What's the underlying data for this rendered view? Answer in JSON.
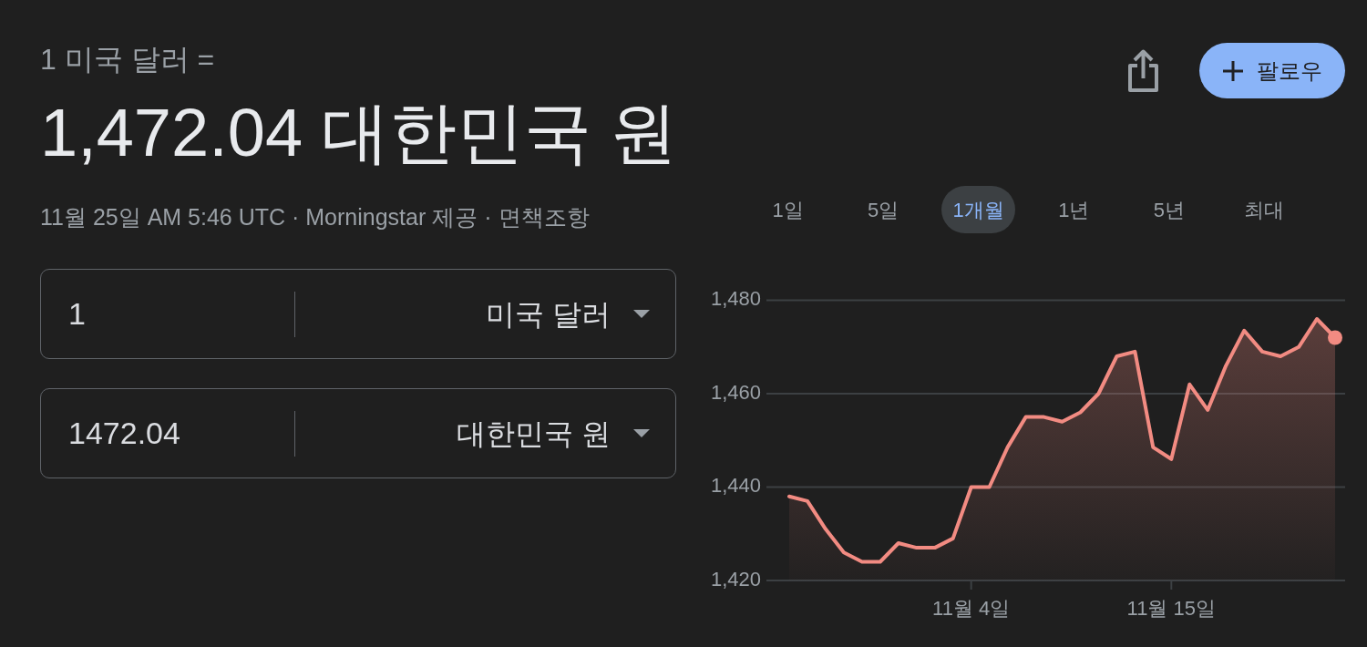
{
  "header": {
    "base_label": "1 미국 달러 =",
    "converted_value": "1,472.04 대한민국 원",
    "update_info": "11월 25일 AM 5:46 UTC · Morningstar 제공 ·",
    "disclaimer_link": "면책조항"
  },
  "actions": {
    "follow_button": "팔로우"
  },
  "converter": [
    {
      "amount": "1",
      "currency": "미국 달러"
    },
    {
      "amount": "1472.04",
      "currency": "대한민국 원"
    }
  ],
  "range_tabs": [
    {
      "label": "1일",
      "selected": false
    },
    {
      "label": "5일",
      "selected": false
    },
    {
      "label": "1개월",
      "selected": true
    },
    {
      "label": "1년",
      "selected": false
    },
    {
      "label": "5년",
      "selected": false
    },
    {
      "label": "최대",
      "selected": false
    }
  ],
  "chart": {
    "chart_data": {
      "type": "area",
      "categories": [
        null,
        null,
        null,
        null,
        null,
        null,
        null,
        null,
        null,
        null,
        "11월 4일",
        null,
        null,
        null,
        null,
        null,
        null,
        null,
        null,
        null,
        null,
        "11월 15일",
        null,
        null,
        null,
        null,
        null,
        null,
        null,
        null,
        null
      ],
      "ylim": [
        1420,
        1480
      ],
      "yticks": [
        {
          "value": 1420,
          "label": "1,420"
        },
        {
          "value": 1440,
          "label": "1,440"
        },
        {
          "value": 1460,
          "label": "1,460"
        },
        {
          "value": 1480,
          "label": "1,480"
        }
      ],
      "series": [
        {
          "color": "#f28b82",
          "values": [
            1438,
            1437,
            1431,
            1426,
            1424,
            1424,
            1428,
            1427,
            1427,
            1429,
            1440,
            1440,
            1448.5,
            1455,
            1455,
            1454,
            1456,
            1460,
            1468,
            1469,
            1448.5,
            1446,
            1462,
            1456.5,
            1466,
            1473.5,
            1469,
            1468,
            1470,
            1476,
            1472
          ]
        }
      ]
    }
  }
}
